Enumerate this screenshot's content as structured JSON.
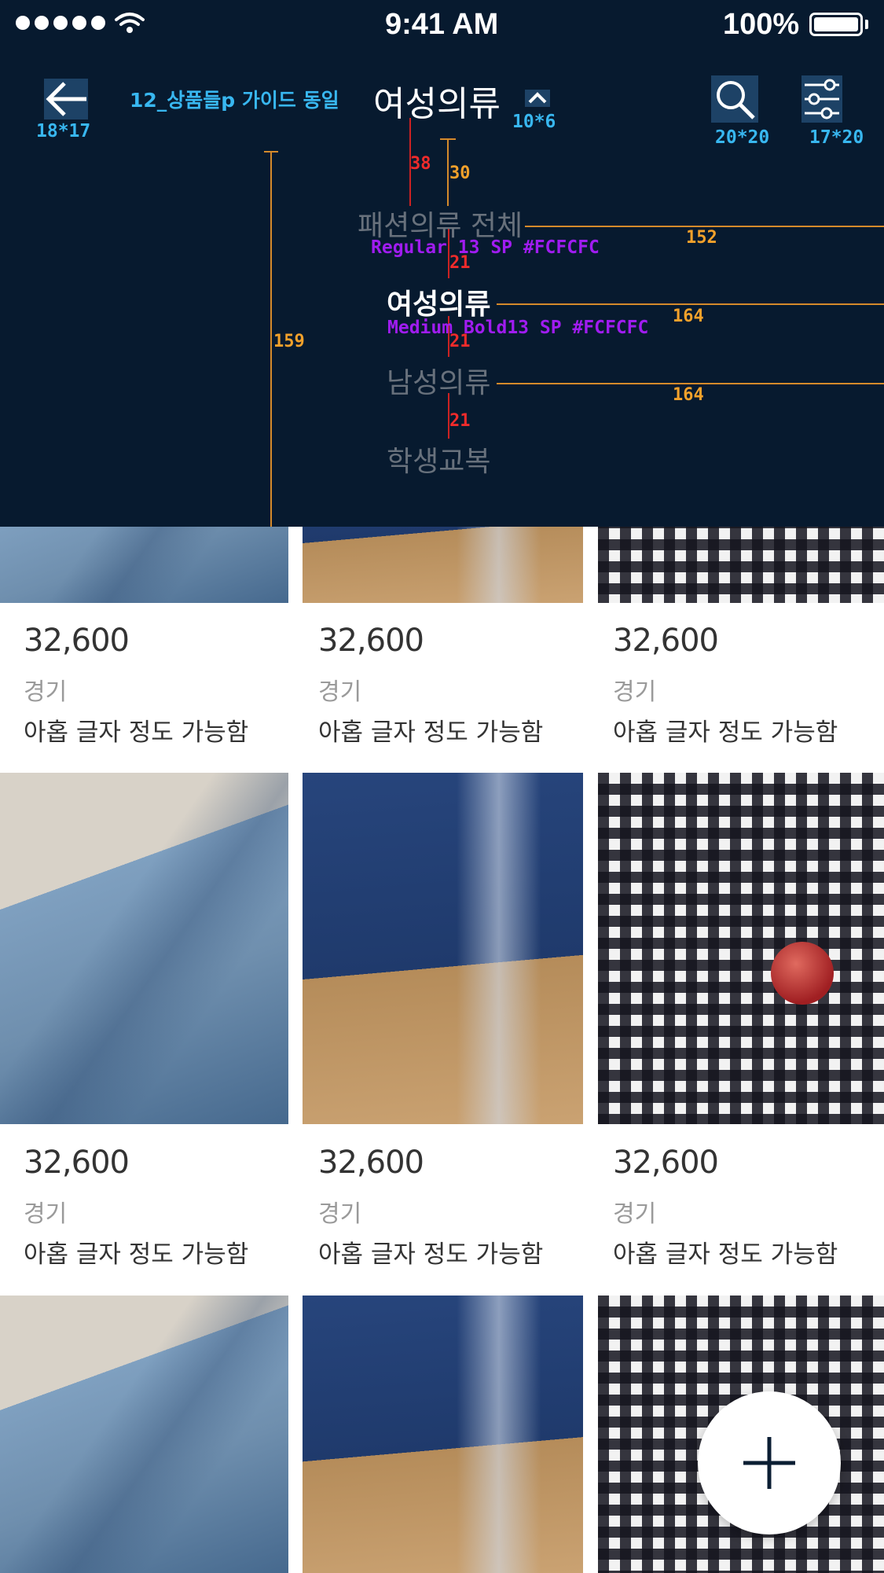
{
  "status_bar": {
    "time": "9:41 AM",
    "battery": "100%"
  },
  "header": {
    "back_size": "18*17",
    "guide_note": "12_상품들p 가이드 동일",
    "title": "여성의류",
    "chevron_size": "10*6",
    "search_size": "20*20",
    "filter_size": "17*20"
  },
  "dropdown": {
    "items": [
      {
        "label": "패션의류 전체"
      },
      {
        "label": "여성의류"
      },
      {
        "label": "남성의류"
      },
      {
        "label": "학생교복"
      }
    ],
    "spec_regular": "Regular 13 SP #FCFCFC",
    "spec_bold": "Medium Bold13 SP #FCFCFC",
    "dim_38": "38",
    "dim_30": "30",
    "dim_159": "159",
    "dim_21a": "21",
    "dim_21b": "21",
    "dim_21c": "21",
    "dim_152": "152",
    "dim_164a": "164",
    "dim_164b": "164"
  },
  "products": [
    {
      "price": "32,600",
      "region": "경기",
      "desc": "아홉 글자 정도 가능함",
      "image": "jeans"
    },
    {
      "price": "32,600",
      "region": "경기",
      "desc": "아홉 글자 정도 가능함",
      "image": "shirt"
    },
    {
      "price": "32,600",
      "region": "경기",
      "desc": "아홉 글자 정도 가능함",
      "image": "plaid"
    },
    {
      "price": "32,600",
      "region": "경기",
      "desc": "아홉 글자 정도 가능함",
      "image": "jeans"
    },
    {
      "price": "32,600",
      "region": "경기",
      "desc": "아홉 글자 정도 가능함",
      "image": "shirt"
    },
    {
      "price": "32,600",
      "region": "경기",
      "desc": "아홉 글자 정도 가능함",
      "image": "plaid"
    }
  ],
  "colors": {
    "header_bg": "#071a2f",
    "annotation_cyan": "#38b7f0",
    "annotation_red": "#ef2b2b",
    "annotation_orange": "#f3a12b",
    "annotation_purple": "#a01cf0"
  },
  "icons": {
    "back": "arrow-left-icon",
    "chevron": "chevron-up-icon",
    "search": "search-icon",
    "filter": "sliders-icon",
    "fab": "plus-icon"
  }
}
